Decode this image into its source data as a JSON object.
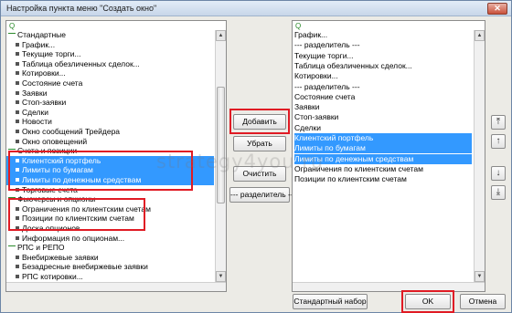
{
  "window": {
    "title": "Настройка пункта меню \"Создать окно\"",
    "close": "✕"
  },
  "search_glyph": "Q",
  "left_tree": [
    {
      "label": "Стандартные",
      "type": "group"
    },
    {
      "label": "График...",
      "type": "item"
    },
    {
      "label": "Текущие торги...",
      "type": "item"
    },
    {
      "label": "Таблица обезличенных сделок...",
      "type": "item"
    },
    {
      "label": "Котировки...",
      "type": "item"
    },
    {
      "label": "Состояние счета",
      "type": "item"
    },
    {
      "label": "Заявки",
      "type": "item"
    },
    {
      "label": "Стоп-заявки",
      "type": "item"
    },
    {
      "label": "Сделки",
      "type": "item"
    },
    {
      "label": "Новости",
      "type": "item"
    },
    {
      "label": "Окно сообщений Трейдера",
      "type": "item"
    },
    {
      "label": "Окно оповещений",
      "type": "item"
    },
    {
      "label": "Счета и позиции",
      "type": "group"
    },
    {
      "label": "Клиентский портфель",
      "type": "item",
      "selected": true
    },
    {
      "label": "Лимиты по бумагам",
      "type": "item",
      "selected": true
    },
    {
      "label": "Лимиты по денежным средствам",
      "type": "item",
      "selected": true
    },
    {
      "label": "Торговые счета",
      "type": "item"
    },
    {
      "label": "Фьючерсы и опционы",
      "type": "group"
    },
    {
      "label": "Ограничения по клиентским счетам",
      "type": "item"
    },
    {
      "label": "Позиции по клиентским счетам",
      "type": "item"
    },
    {
      "label": "Доска опционов...",
      "type": "item"
    },
    {
      "label": "Информация по опционам...",
      "type": "item"
    },
    {
      "label": "РПС и РЕПО",
      "type": "group"
    },
    {
      "label": "Внебиржевые заявки",
      "type": "item"
    },
    {
      "label": "Безадресные внебиржевые заявки",
      "type": "item"
    },
    {
      "label": "РПС котировки...",
      "type": "item"
    }
  ],
  "right_list": [
    {
      "label": "График..."
    },
    {
      "label": "--- разделитель ---"
    },
    {
      "label": "Текущие торги..."
    },
    {
      "label": "Таблица обезличенных сделок..."
    },
    {
      "label": "Котировки..."
    },
    {
      "label": "--- разделитель ---"
    },
    {
      "label": "Состояние счета"
    },
    {
      "label": "Заявки"
    },
    {
      "label": "Стоп-заявки"
    },
    {
      "label": "Сделки"
    },
    {
      "label": "Клиентский портфель",
      "selected": true
    },
    {
      "label": "Лимиты по бумагам",
      "selected": true
    },
    {
      "label": "Лимиты по денежным средствам",
      "selected": true
    },
    {
      "label": "Ограничения по клиентским счетам"
    },
    {
      "label": "Позиции по клиентским счетам"
    }
  ],
  "buttons": {
    "add": "Добавить",
    "remove": "Убрать",
    "clear": "Очистить",
    "separator": "--- разделитель ---",
    "standard_set": "Стандартный набор",
    "ok": "OK",
    "cancel": "Отмена"
  },
  "watermark": "strategy4you.ru"
}
